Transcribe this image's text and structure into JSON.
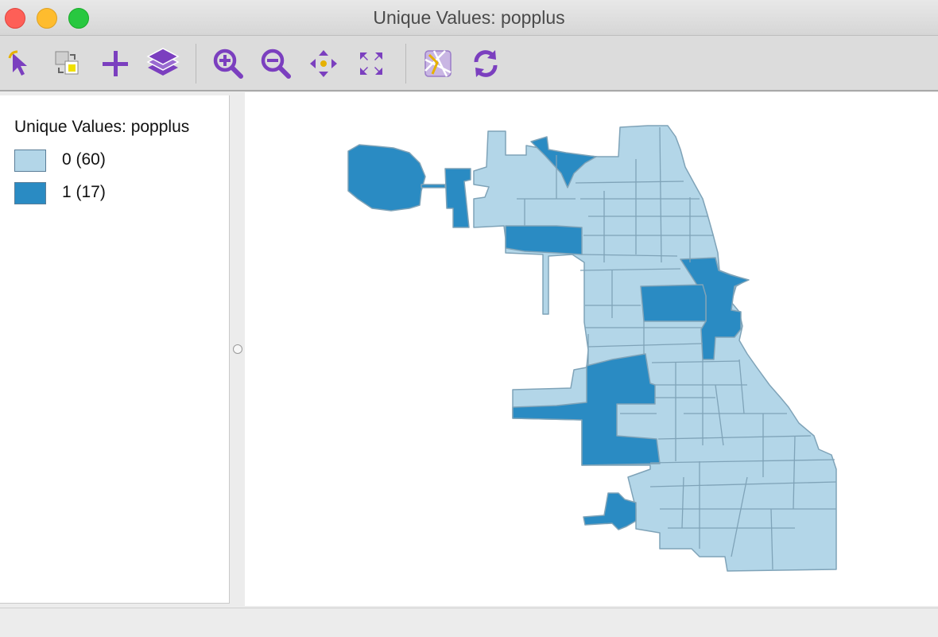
{
  "window": {
    "title": "Unique Values: popplus"
  },
  "toolbar": {
    "buttons": [
      {
        "icon": "select-pointer-icon"
      },
      {
        "icon": "selection-shape-icon"
      },
      {
        "icon": "add-plus-icon"
      },
      {
        "icon": "layers-icon"
      },
      {
        "icon": "zoom-in-icon"
      },
      {
        "icon": "zoom-out-icon"
      },
      {
        "icon": "pan-icon"
      },
      {
        "icon": "full-extent-icon"
      },
      {
        "icon": "basemap-icon"
      },
      {
        "icon": "refresh-icon"
      }
    ],
    "icon_color": "#7b3fbf"
  },
  "legend": {
    "title": "Unique Values: popplus",
    "items": [
      {
        "label": "0 (60)",
        "color": "#b3d6e8"
      },
      {
        "label": "1 (17)",
        "color": "#2a8bc3"
      }
    ]
  },
  "map": {
    "variable": "popplus",
    "colors": {
      "0": "#b3d6e8",
      "1": "#2a8bc3",
      "outline": "#7fa3b8"
    }
  }
}
